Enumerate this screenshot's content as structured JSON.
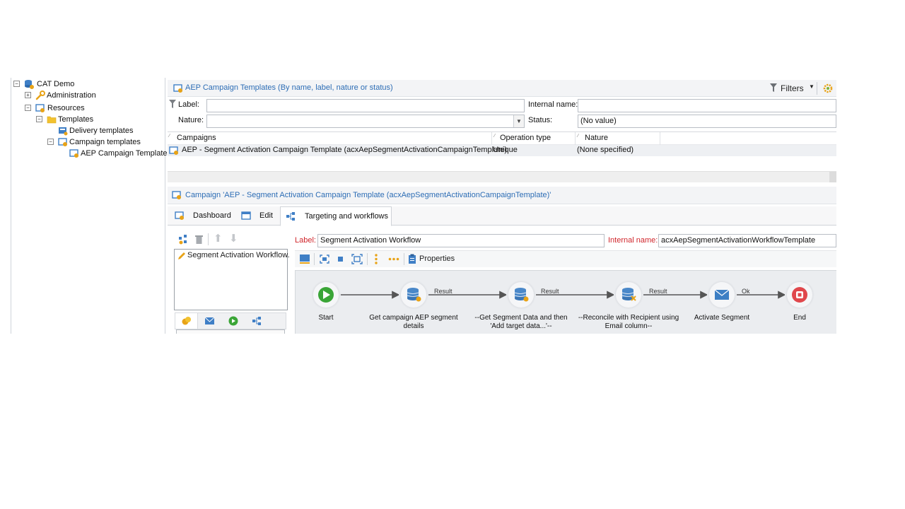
{
  "tree": {
    "root": "CAT Demo",
    "administration": "Administration",
    "resources": "Resources",
    "templates": "Templates",
    "delivery_templates": "Delivery templates",
    "campaign_templates": "Campaign templates",
    "aep_campaign_templates": "AEP Campaign Templates"
  },
  "list_panel": {
    "title": "AEP Campaign Templates (By name, label, nature or status)",
    "filters_label": "Filters",
    "label_field_label": "Label:",
    "label_value": "",
    "internal_name_label": "Internal name:",
    "internal_name_value": "",
    "nature_label": "Nature:",
    "nature_value": "",
    "status_label": "Status:",
    "status_value": "(No value)",
    "columns": [
      "Campaigns",
      "Operation type",
      "Nature"
    ],
    "rows": [
      {
        "campaign": "AEP - Segment Activation Campaign Template (acxAepSegmentActivationCampaignTemplate)",
        "operation_type": "Unique",
        "nature": "(None specified)"
      }
    ]
  },
  "detail": {
    "title": "Campaign 'AEP - Segment Activation Campaign Template (acxAepSegmentActivationCampaignTemplate)'",
    "tabs": [
      "Dashboard",
      "Edit",
      "Targeting and workflows"
    ],
    "active_tab": "Targeting and workflows",
    "workflow_list": [
      "Segment Activation Workflow."
    ],
    "label_label": "Label:",
    "label_value": "Segment Activation Workflow",
    "internal_name_label": "Internal name:",
    "internal_name_value": "acxAepSegmentActivationWorkflowTemplate",
    "properties_label": "Properties"
  },
  "workflow": {
    "nodes": [
      {
        "id": "start",
        "label1": "Start",
        "label2": "",
        "icon": "play-icon",
        "color": "#3aa537"
      },
      {
        "id": "get-aep",
        "label1": "Get campaign AEP segment",
        "label2": "details",
        "icon": "query-icon",
        "color": "#4a88c9"
      },
      {
        "id": "get-seg",
        "label1": "--Get Segment Data and then",
        "label2": "'Add target data...'--",
        "icon": "query-icon",
        "color": "#4a88c9"
      },
      {
        "id": "reconcile",
        "label1": "--Reconcile with Recipient using",
        "label2": "Email column--",
        "icon": "reconcile-icon",
        "color": "#4a88c9"
      },
      {
        "id": "activate",
        "label1": "Activate Segment",
        "label2": "",
        "icon": "email-icon",
        "color": "#3d7fc4"
      },
      {
        "id": "end",
        "label1": "End",
        "label2": "",
        "icon": "stop-icon",
        "color": "#e0474c"
      }
    ],
    "transitions": [
      "Result",
      "Result",
      "Result",
      "Ok"
    ]
  },
  "colors": {
    "link_blue": "#2d6db5",
    "required_red": "#d0252b",
    "folder_yellow": "#f2c230"
  }
}
